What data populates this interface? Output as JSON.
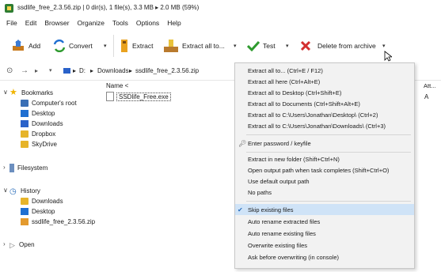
{
  "window": {
    "title": "ssdlife_free_2.3.56.zip | 0 dir(s), 1 file(s), 3.3 MB ▸ 2.0 MB (59%)"
  },
  "menu_bar": [
    "File",
    "Edit",
    "Browser",
    "Organize",
    "Tools",
    "Options",
    "Help"
  ],
  "toolbar": {
    "add": "Add",
    "convert": "Convert",
    "extract": "Extract",
    "extract_all_to": "Extract all to...",
    "test": "Test",
    "delete_from_archive": "Delete from archive"
  },
  "address": {
    "drive": "D:",
    "path_1": "Downloads",
    "path_2": "ssdlife_free_2.3.56.zip"
  },
  "tree": {
    "bookmarks": "Bookmarks",
    "computers_root": "Computer's root",
    "desktop": "Desktop",
    "downloads": "Downloads",
    "dropbox": "Dropbox",
    "skydrive": "SkyDrive",
    "filesystem": "Filesystem",
    "history": "History",
    "h_downloads": "Downloads",
    "h_desktop": "Desktop",
    "h_zip": "ssdlife_free_2.3.56.zip",
    "open": "Open"
  },
  "filelist": {
    "col_name": "Name <",
    "col_att": "Att...",
    "rows": [
      {
        "name": "SSDlife_Free.exe",
        "att": "A"
      }
    ]
  },
  "context_menu": {
    "items": [
      "Extract all to... (Ctrl+E / F12)",
      "Extract all here (Ctrl+Alt+E)",
      "Extract all to Desktop (Ctrl+Shift+E)",
      "Extract all to Documents (Ctrl+Shift+Alt+E)",
      "Extract all to C:\\Users\\Jonathan\\Desktop\\ (Ctrl+2)",
      "Extract all to C:\\Users\\Jonathan\\Downloads\\ (Ctrl+3)",
      "Enter password / keyfile",
      "Extract in new folder (Shift+Ctrl+N)",
      "Open output path when task completes (Shift+Ctrl+O)",
      "Use default output path",
      "No paths",
      "Skip existing files",
      "Auto rename extracted files",
      "Auto rename existing files",
      "Overwrite existing files",
      "Ask before overwriting (in console)"
    ],
    "checked_item": "Skip existing files"
  },
  "colors": {
    "accent": "#2a6ebb",
    "menu_highlight": "#cfe3f7",
    "delete_red": "#d32f2f",
    "test_green": "#2e9a2e"
  }
}
